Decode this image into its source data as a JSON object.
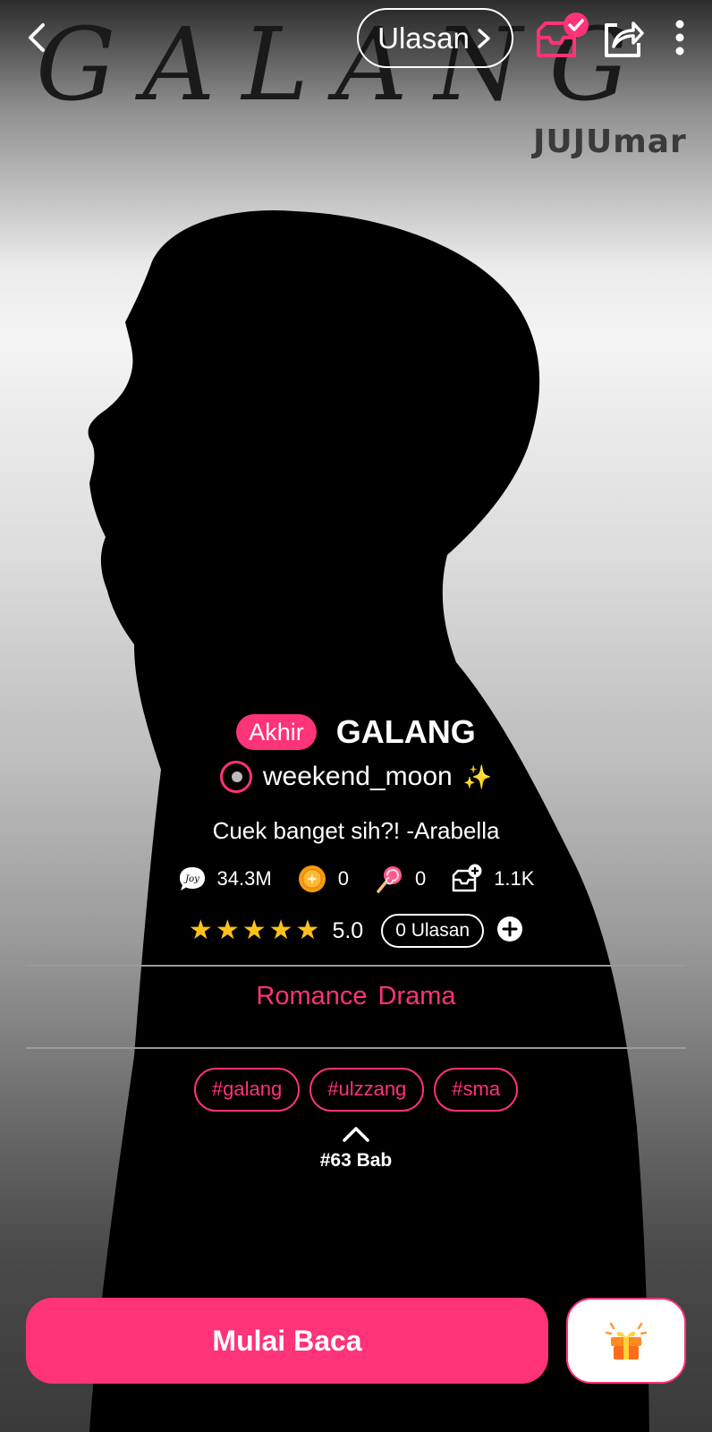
{
  "cover": {
    "title_art": "GALANG",
    "author_art": "JUJUmar"
  },
  "topbar": {
    "back_icon": "chevron-left-icon",
    "reviews_label": "Ulasan",
    "library_icon": "library-added-icon",
    "share_icon": "share-icon",
    "more_icon": "more-vertical-icon"
  },
  "book": {
    "status": "Akhir",
    "title": "GALANG",
    "author": "weekend_moon",
    "author_emoji": "✨",
    "tagline": "Cuek banget sih?!  -Arabella",
    "stats": {
      "reads": "34.3M",
      "coins": "0",
      "lollipops": "0",
      "library_adds": "1.1K"
    },
    "rating": "5.0",
    "stars": 5,
    "reviews_label": "0 Ulasan",
    "genres": [
      "Romance",
      "Drama"
    ],
    "tags": [
      "#galang",
      "#ulzzang",
      "#sma"
    ],
    "chapters": "#63 Bab"
  },
  "actions": {
    "start_label": "Mulai Baca",
    "gift_icon": "gift-icon"
  },
  "colors": {
    "accent": "#ff3377",
    "star": "#ffc21a"
  }
}
